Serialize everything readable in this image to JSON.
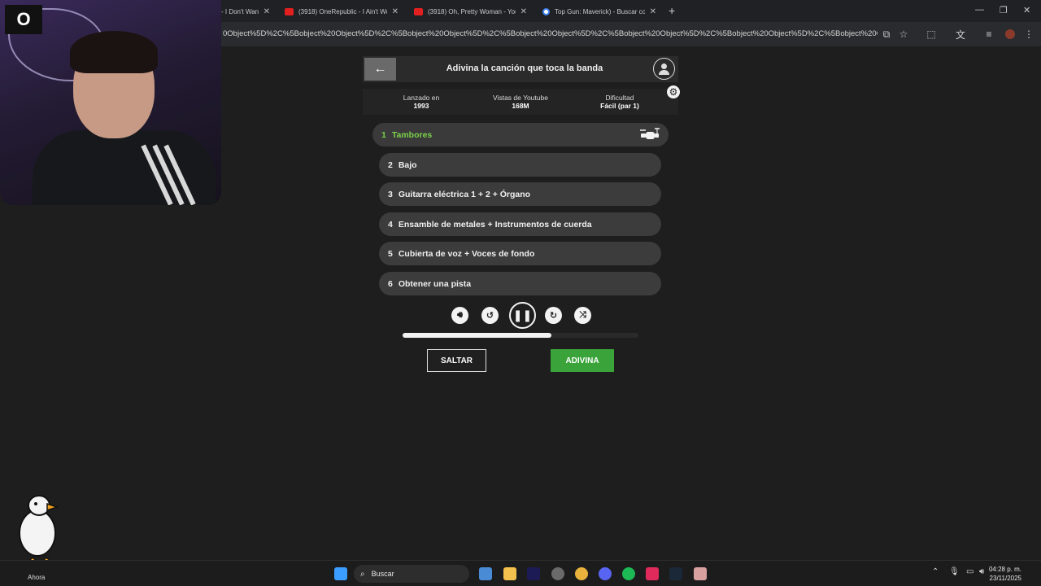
{
  "browser": {
    "tabs": [
      {
        "title": "- I Don't Wan",
        "icon": "youtube-icon"
      },
      {
        "title": "(3918) OneRepublic - I Ain't Wo",
        "icon": "youtube-icon"
      },
      {
        "title": "(3918) Oh, Pretty Woman - You",
        "icon": "youtube-icon"
      },
      {
        "title": "Top Gun: Maverick) - Buscar co",
        "icon": "google-icon"
      }
    ],
    "new_tab": "+",
    "url": "0Object%5D%2C%5Bobject%20Object%5D%2C%5Bobject%20Object%5D%2C%5Bobject%20Object%5D%2C%5Bobject%20Object%5D%2C%5Bobject%20Object%5D%2C%5Bobject%20Object%5D%2C%5Bobject%20Object..."
  },
  "webcam": {
    "logo": "O"
  },
  "game": {
    "title": "Adivina la canción que toca la banda",
    "info": [
      {
        "label": "Lanzado en",
        "value": "1993"
      },
      {
        "label": "Vistas de Youtube",
        "value": "168M"
      },
      {
        "label": "Dificultad",
        "value": "Fácil (par 1)"
      }
    ],
    "stems": [
      {
        "num": "1",
        "label": "Tambores"
      },
      {
        "num": "2",
        "label": "Bajo"
      },
      {
        "num": "3",
        "label": "Guitarra eléctrica 1 + 2 + Órgano"
      },
      {
        "num": "4",
        "label": "Ensamble de metales + Instrumentos de cuerda"
      },
      {
        "num": "5",
        "label": "Cubierta de voz + Voces de fondo"
      },
      {
        "num": "6",
        "label": "Obtener una pista"
      }
    ],
    "active_stem": 1,
    "progress": 0.63,
    "skip_label": "SALTAR",
    "guess_label": "ADIVINA",
    "accent": "#3aa33a",
    "active_color": "#7bd14a"
  },
  "taskbar": {
    "weather_label": "Ahora",
    "search_placeholder": "Buscar",
    "time": "04:28 p. m.",
    "date": "23/11/2025"
  }
}
